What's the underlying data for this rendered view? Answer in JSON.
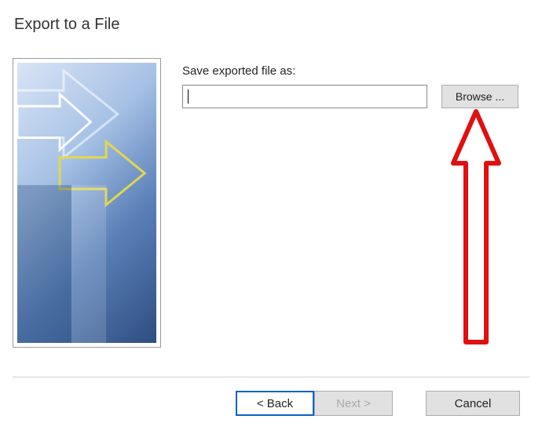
{
  "title": "Export to a File",
  "label_save": "Save exported file as:",
  "file_input_value": "",
  "browse_label": "Browse ...",
  "buttons": {
    "back": "< Back",
    "next": "Next >",
    "cancel": "Cancel"
  }
}
